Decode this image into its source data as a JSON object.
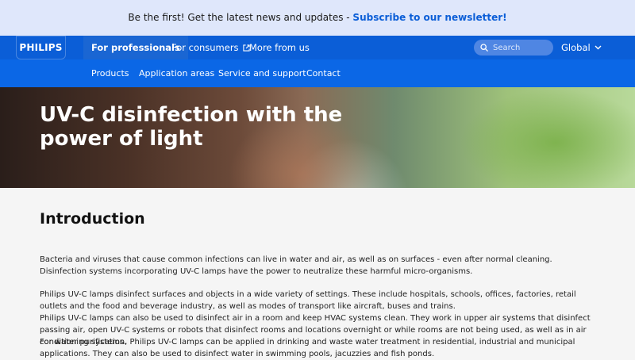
{
  "banner": {
    "text": "Be the first! Get the latest news and updates - ",
    "link": "Subscribe to our newsletter!"
  },
  "logo": {
    "text": "PHILIPS"
  },
  "topnav": {
    "items": [
      {
        "label": "For professionals",
        "active": true
      },
      {
        "label": "For consumers",
        "external": true
      },
      {
        "label": "More from us"
      }
    ],
    "search_placeholder": "Search",
    "region": "Global"
  },
  "subnav": {
    "items": [
      "Products",
      "Application areas",
      "Service and support",
      "Contact"
    ]
  },
  "hero": {
    "title": "UV-C disinfection with the power of light"
  },
  "intro": {
    "heading": "Introduction",
    "paragraphs": [
      "Bacteria and viruses that cause common infections can live in water and air, as well as on surfaces - even after normal cleaning. Disinfection systems incorporating UV-C lamps have the power to neutralize these harmful micro-organisms.",
      "Philips UV-C lamps disinfect surfaces and objects in a wide variety of settings. These include hospitals, schools, offices, factories, retail outlets and the food and beverage industry, as well as modes of transport like aircraft, buses and trains.",
      "Philips UV-C lamps can also be used to disinfect air in a room and keep HVAC systems clean. They work in upper air systems that disinfect passing air, open UV-C systems or robots that disinfect rooms and locations overnight or while rooms are not being used, as well as in air conditioning systems.",
      "For water purification, Philips UV-C lamps can be applied in drinking and waste water treatment in residential, industrial and municipal applications. They can also be used to disinfect water in swimming pools, jacuzzies and fish ponds."
    ]
  },
  "colors": {
    "brand_blue": "#0b5ed7",
    "banner_bg": "#dfe7fb",
    "link": "#0b5ed7"
  }
}
